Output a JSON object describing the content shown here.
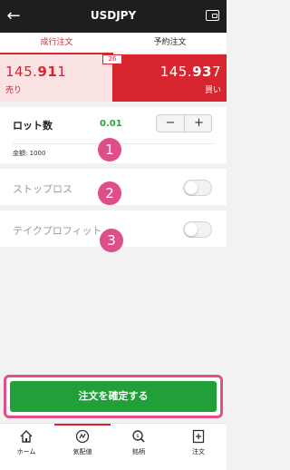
{
  "header": {
    "title": "USDJPY",
    "back_icon": "arrow-left-icon",
    "wallet_icon": "wallet-icon"
  },
  "tabs": [
    {
      "label": "成行注文",
      "active": true
    },
    {
      "label": "予約注文",
      "active": false
    }
  ],
  "prices": {
    "sell": {
      "main": "145.",
      "big": "91",
      "tail": "1",
      "label": "売り"
    },
    "buy": {
      "main": "145.",
      "big": "93",
      "tail": "7",
      "label": "買い"
    },
    "spread": "26"
  },
  "lot": {
    "label": "ロット数",
    "value": "0.01",
    "minus": "−",
    "plus": "+",
    "amount": "金額: 1000"
  },
  "stoploss": {
    "label": "ストップロス",
    "enabled": false
  },
  "takeprofit": {
    "label": "テイクプロフィット",
    "enabled": false
  },
  "markers": [
    "1",
    "2",
    "3"
  ],
  "confirm_label": "注文を確定する",
  "nav": [
    {
      "label": "ホーム",
      "icon": "home-icon"
    },
    {
      "label": "気配値",
      "icon": "rates-icon"
    },
    {
      "label": "銘柄",
      "icon": "symbol-search-icon"
    },
    {
      "label": "注文",
      "icon": "order-icon"
    }
  ],
  "colors": {
    "accent": "#d72630",
    "confirm": "#21a039",
    "marker": "#dd4f86",
    "lot_value": "#2ea043"
  }
}
